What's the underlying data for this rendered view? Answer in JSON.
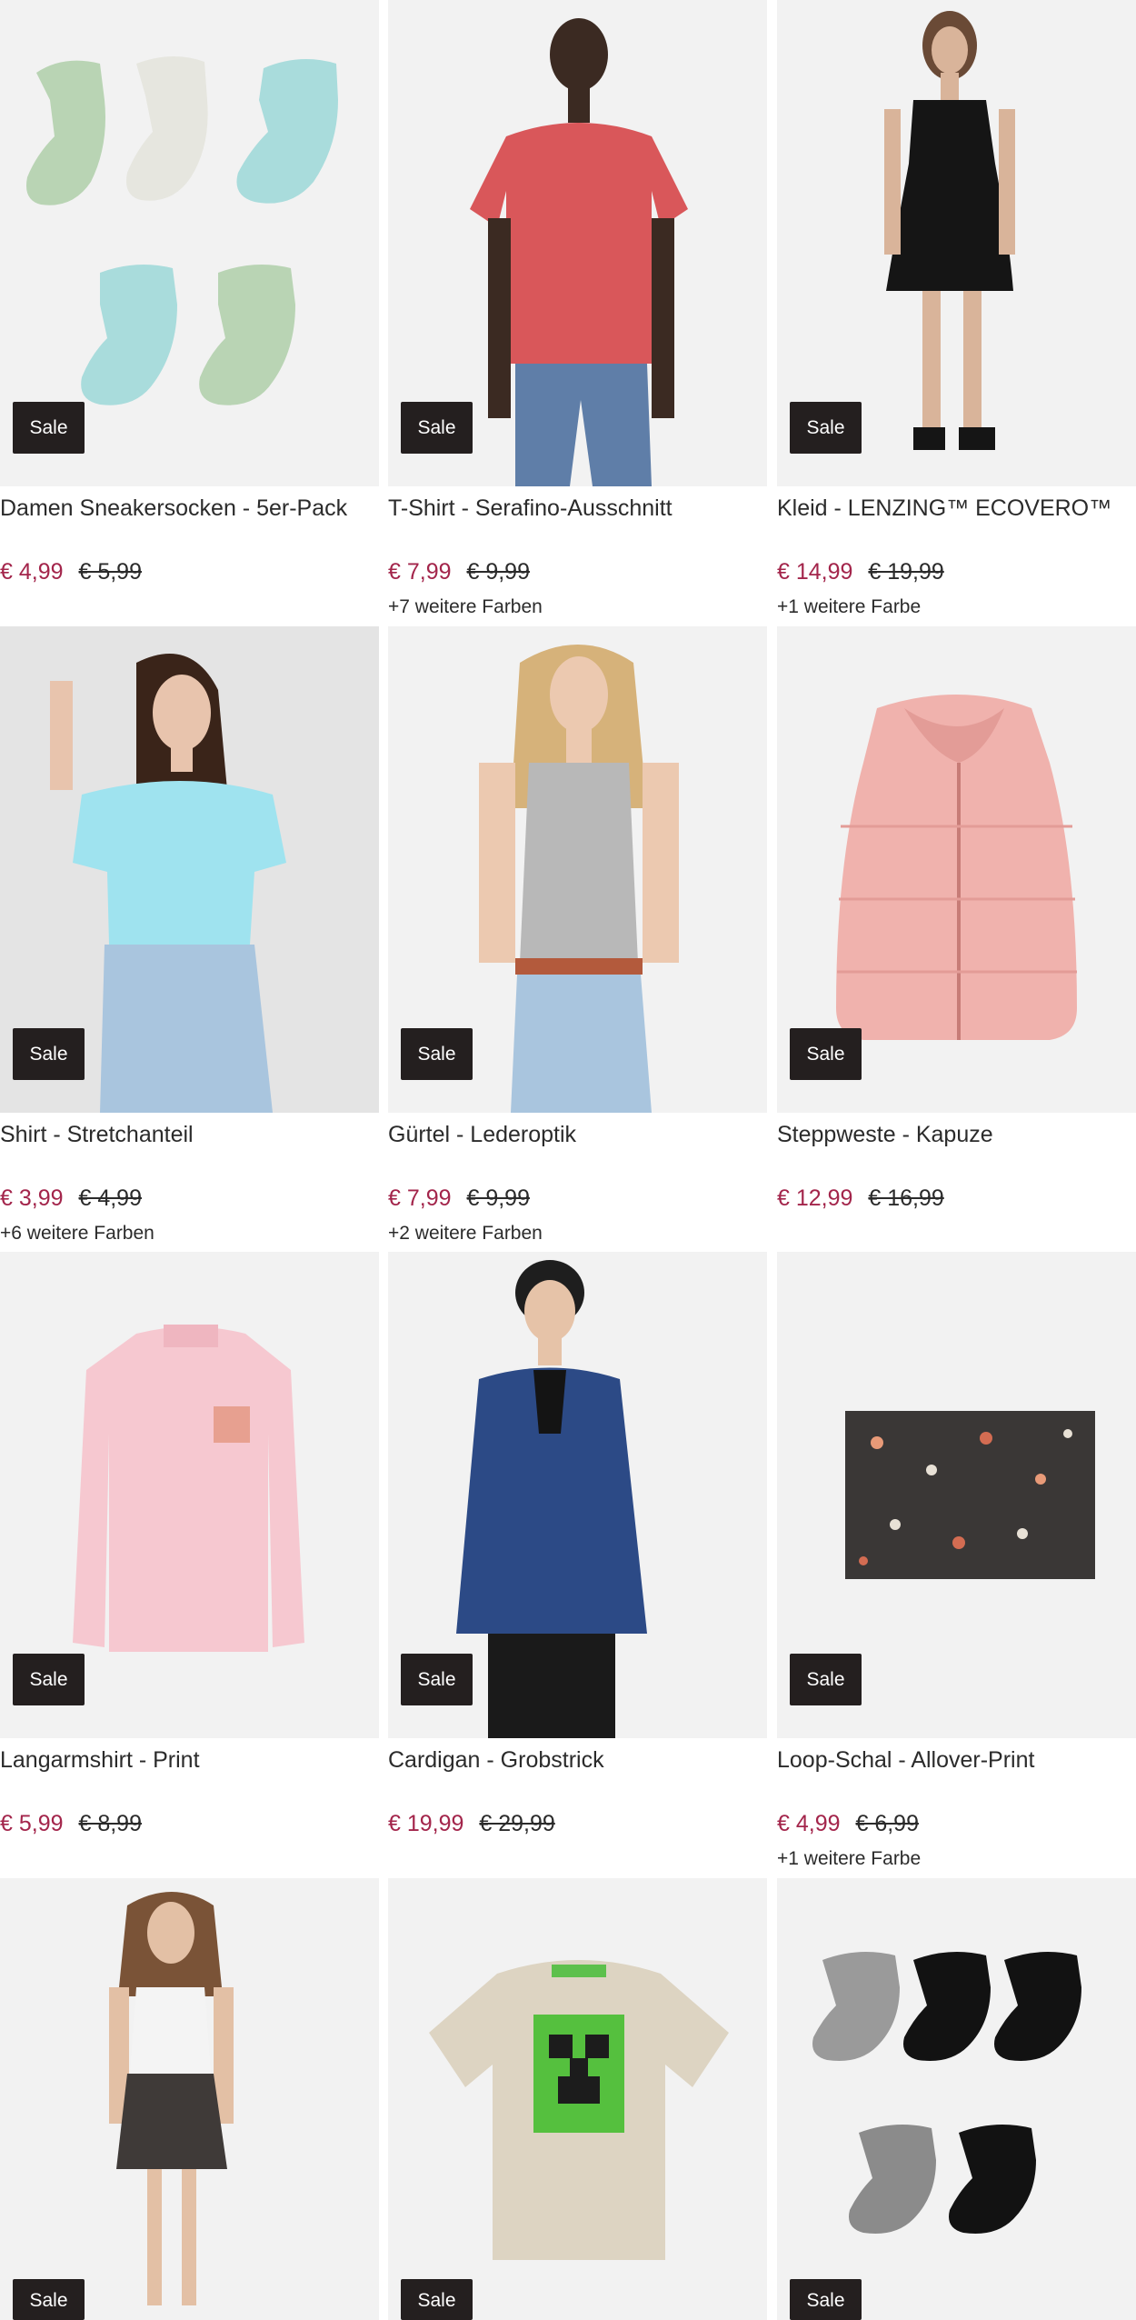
{
  "products": [
    {
      "title": "Damen Sneakersocken - 5er-Pack",
      "price_new": "€ 4,99",
      "price_old": "€ 5,99",
      "colors": "",
      "badge": "Sale",
      "image_icon": "socks-pastel-image"
    },
    {
      "title": "T-Shirt - Serafino-Ausschnitt",
      "price_new": "€ 7,99",
      "price_old": "€ 9,99",
      "colors": "+7 weitere Farben",
      "badge": "Sale",
      "image_icon": "man-red-tshirt-image"
    },
    {
      "title": "Kleid - LENZING™ ECOVERO™",
      "price_new": "€ 14,99",
      "price_old": "€ 19,99",
      "colors": "+1 weitere Farbe",
      "badge": "Sale",
      "image_icon": "woman-black-dress-image"
    },
    {
      "title": "Shirt - Stretchanteil",
      "price_new": "€ 3,99",
      "price_old": "€ 4,99",
      "colors": "+6 weitere Farben",
      "badge": "Sale",
      "image_icon": "woman-blue-shirt-image"
    },
    {
      "title": "Gürtel - Lederoptik",
      "price_new": "€ 7,99",
      "price_old": "€ 9,99",
      "colors": "+2 weitere Farben",
      "badge": "Sale",
      "image_icon": "woman-belt-image"
    },
    {
      "title": "Steppweste - Kapuze",
      "price_new": "€ 12,99",
      "price_old": "€ 16,99",
      "colors": "",
      "badge": "Sale",
      "image_icon": "pink-vest-image"
    },
    {
      "title": "Langarmshirt - Print",
      "price_new": "€ 5,99",
      "price_old": "€ 8,99",
      "colors": "",
      "badge": "Sale",
      "image_icon": "pink-longsleeve-image"
    },
    {
      "title": "Cardigan - Grobstrick",
      "price_new": "€ 19,99",
      "price_old": "€ 29,99",
      "colors": "",
      "badge": "Sale",
      "image_icon": "man-blue-cardigan-image"
    },
    {
      "title": "Loop-Schal - Allover-Print",
      "price_new": "€ 4,99",
      "price_old": "€ 6,99",
      "colors": "+1 weitere Farbe",
      "badge": "Sale",
      "image_icon": "printed-scarf-image"
    },
    {
      "title": "",
      "price_new": "",
      "price_old": "",
      "colors": "",
      "badge": "Sale",
      "image_icon": "woman-skirt-image"
    },
    {
      "title": "",
      "price_new": "",
      "price_old": "",
      "colors": "",
      "badge": "Sale",
      "image_icon": "minecraft-tshirt-image"
    },
    {
      "title": "",
      "price_new": "",
      "price_old": "",
      "colors": "",
      "badge": "Sale",
      "image_icon": "gamer-socks-image"
    }
  ],
  "colors": {
    "sale_badge_bg": "#241f1f",
    "sale_badge_text": "#ffffff",
    "price_new": "#a3254b",
    "text": "#2b2b2b",
    "image_bg": "#f2f2f2"
  }
}
